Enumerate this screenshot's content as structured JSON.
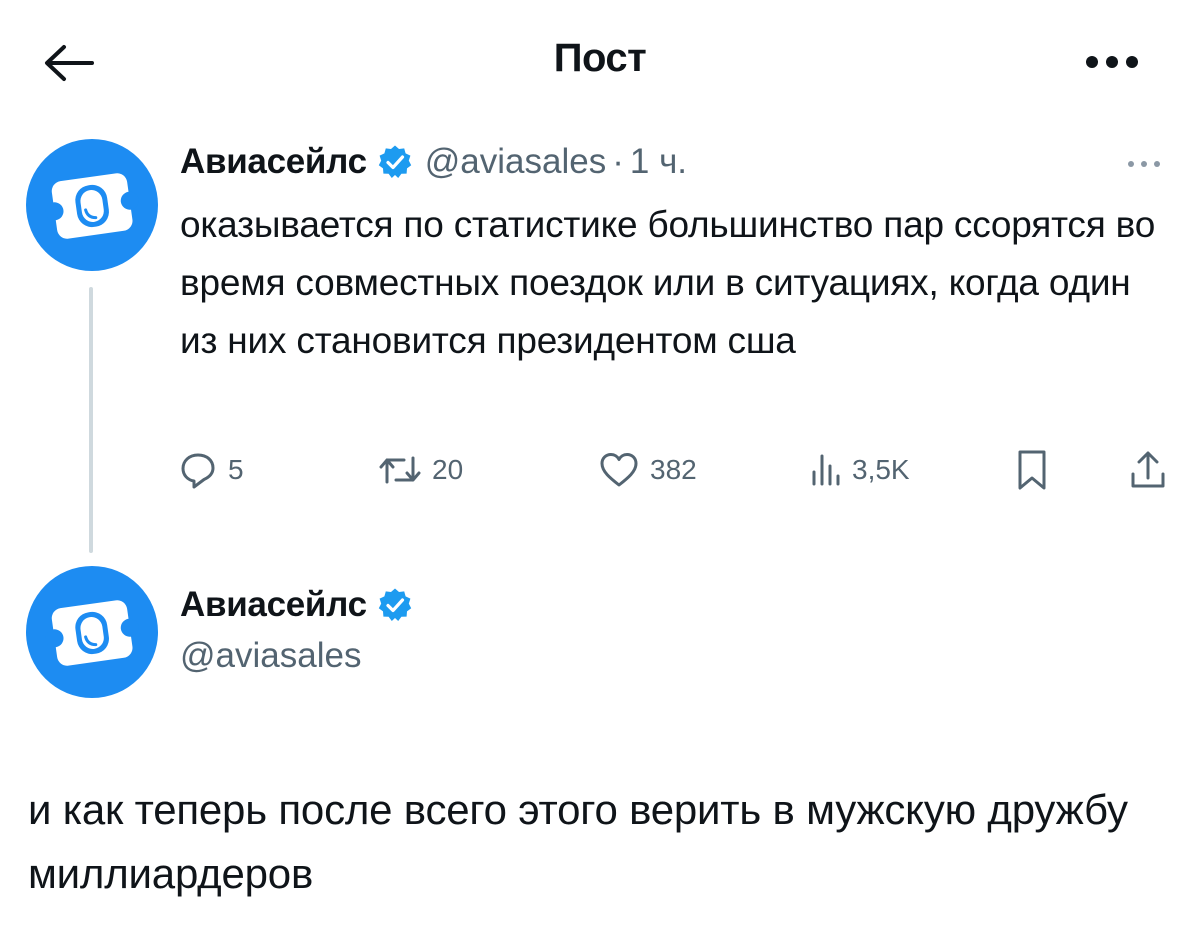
{
  "header": {
    "title": "Пост",
    "back_icon": "arrow-left-icon",
    "more_icon": "more-horizontal-icon"
  },
  "colors": {
    "brand_blue": "#1d8cf2",
    "verified_blue": "#1d9bf0",
    "text_primary": "#0f1419",
    "text_secondary": "#536471",
    "thread_line": "#cfd9de"
  },
  "tweet1": {
    "author_name": "Авиасейлс",
    "handle": "@aviasales",
    "separator": "·",
    "time": "1 ч.",
    "text": "оказывается по статистике большинство пар ссорятся во время совместных поездок или в ситуациях, когда один из них становится президентом сша",
    "actions": {
      "replies": "5",
      "retweets": "20",
      "likes": "382",
      "views": "3,5K"
    }
  },
  "tweet2": {
    "author_name": "Авиасейлс",
    "handle": "@aviasales",
    "text": "и как теперь после всего этого верить в мужскую дружбу миллиардеров"
  }
}
